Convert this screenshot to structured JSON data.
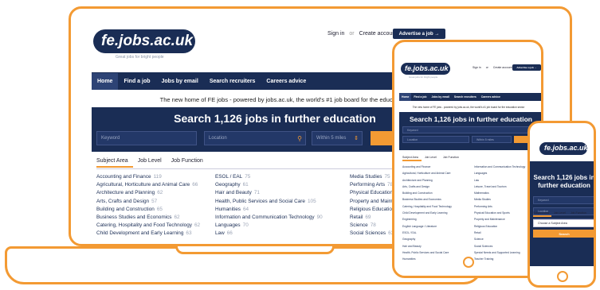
{
  "colors": {
    "brand_navy": "#1a2d55",
    "accent_orange": "#f39a33"
  },
  "site": {
    "logo": "fe.jobs.ac.uk",
    "tagline": "Great jobs for bright people",
    "signin": "Sign in",
    "or": "or",
    "create_account": "Create account",
    "advertise": "Advertise a job →",
    "nav": [
      "Home",
      "Find a job",
      "Jobs by email",
      "Search recruiters",
      "Careers advice"
    ],
    "banner": "The new home of FE jobs - powered by jobs.ac.uk, the world's #1 job board for the education sector",
    "search_title": "Search 1,126 jobs in further education",
    "keyword_placeholder": "Keyword",
    "location_placeholder": "Location",
    "radius": "Within 5 miles",
    "search_button": "S",
    "tabs": [
      "Subject Area",
      "Job Level",
      "Job Function"
    ],
    "col1": [
      {
        "name": "Accounting and Finance",
        "count": "119"
      },
      {
        "name": "Agricultural, Horticulture and Animal Care",
        "count": "66"
      },
      {
        "name": "Architecture and Planning",
        "count": "62"
      },
      {
        "name": "Arts, Crafts and Design",
        "count": "57"
      },
      {
        "name": "Building and Construction",
        "count": "65"
      },
      {
        "name": "Business Studies and Economics",
        "count": "62"
      },
      {
        "name": "Catering, Hospitality and Food Technology",
        "count": "62"
      },
      {
        "name": "Child Development and Early Learning",
        "count": "63"
      }
    ],
    "col2": [
      {
        "name": "ESOL / EAL",
        "count": "75"
      },
      {
        "name": "Geography",
        "count": "61"
      },
      {
        "name": "Hair and Beauty",
        "count": "71"
      },
      {
        "name": "Health, Public Services and Social Care",
        "count": "105"
      },
      {
        "name": "Humanities",
        "count": "64"
      },
      {
        "name": "Information and Communication Technology",
        "count": "90"
      },
      {
        "name": "Languages",
        "count": "70"
      },
      {
        "name": "Law",
        "count": "66"
      }
    ],
    "col3": [
      {
        "name": "Media Studies",
        "count": "75"
      },
      {
        "name": "Performing Arts",
        "count": "78"
      },
      {
        "name": "Physical Education and Sports",
        "count": "80"
      },
      {
        "name": "Property and Maintenance",
        "count": "77"
      },
      {
        "name": "Religious Education",
        "count": "50"
      },
      {
        "name": "Retail",
        "count": "69"
      },
      {
        "name": "Science",
        "count": "78"
      },
      {
        "name": "Social Sciences",
        "count": "63"
      }
    ]
  },
  "tablet": {
    "tab_col1": [
      "Accounting and Finance",
      "Agricultural, Horticulture and Animal Care",
      "Architecture and Planning",
      "Arts, Crafts and Design",
      "Building and Construction",
      "Business Studies and Economics",
      "Catering, Hospitality and Food Technology",
      "Child Development and Early Learning",
      "Engineering",
      "English Language / Literature",
      "ESOL / EAL",
      "Geography",
      "Hair and Beauty",
      "Health, Public Services and Social Care",
      "Humanities"
    ],
    "tab_col2": [
      "Information and Communication Technology",
      "Languages",
      "Law",
      "Leisure, Travel and Tourism",
      "Mathematics",
      "Media Studies",
      "Performing Arts",
      "Physical Education and Sports",
      "Property and Maintenance",
      "Religious Education",
      "Retail",
      "Science",
      "Social Sciences",
      "Special Needs and Supported Learning",
      "Teacher Training"
    ]
  },
  "phone": {
    "search_title": "Search 1,126 jobs in further education",
    "keyword_placeholder": "Keyword",
    "location_placeholder": "Location",
    "radius": "Within 5 miles",
    "search_button": "Search",
    "tabs": [
      "Subject Area",
      "Job Level",
      "Job Function"
    ],
    "choose": "Choose a Subject Area"
  }
}
